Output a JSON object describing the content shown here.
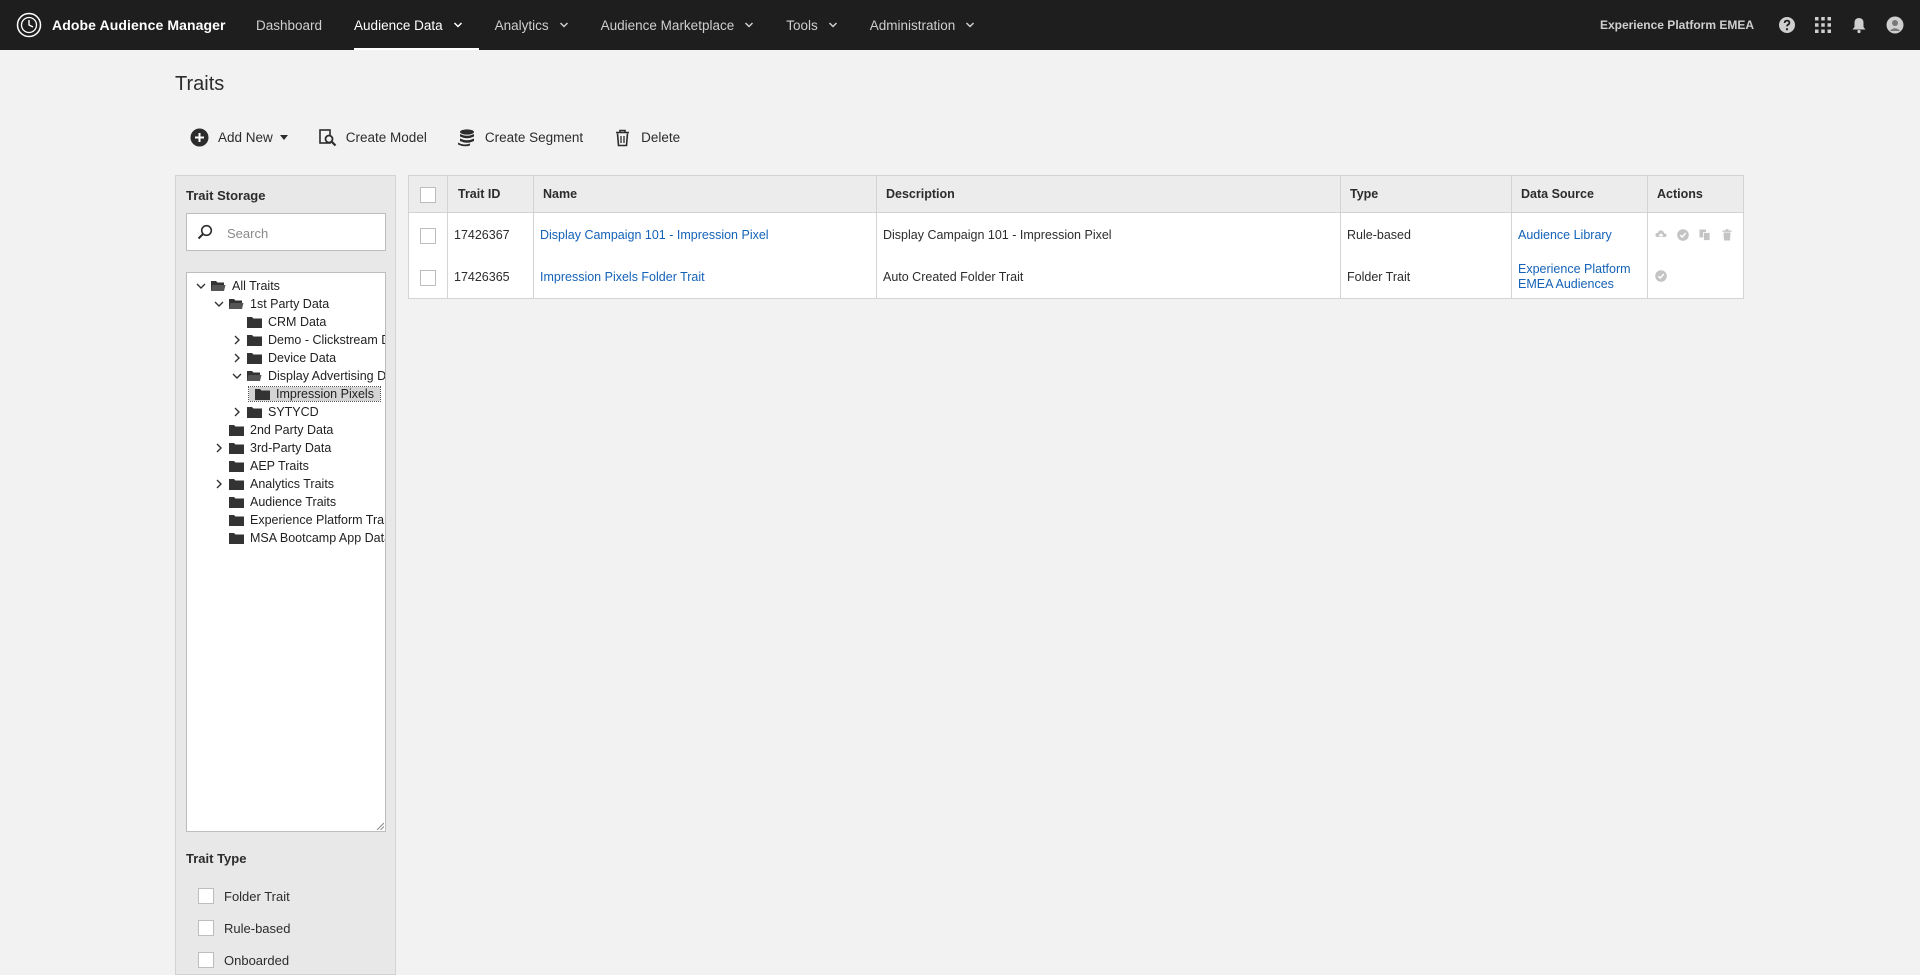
{
  "app": {
    "name": "Adobe Audience Manager"
  },
  "nav": {
    "items": [
      {
        "label": "Dashboard",
        "active": false,
        "dropdown": false
      },
      {
        "label": "Audience Data",
        "active": true,
        "dropdown": true
      },
      {
        "label": "Analytics",
        "active": false,
        "dropdown": true
      },
      {
        "label": "Audience Marketplace",
        "active": false,
        "dropdown": true
      },
      {
        "label": "Tools",
        "active": false,
        "dropdown": true
      },
      {
        "label": "Administration",
        "active": false,
        "dropdown": true
      }
    ],
    "org": "Experience Platform EMEA",
    "icons": [
      "help-icon",
      "apps-grid-icon",
      "bell-icon",
      "avatar-icon"
    ]
  },
  "page": {
    "title": "Traits"
  },
  "toolbar": {
    "add_new": "Add New",
    "create_model": "Create Model",
    "create_segment": "Create Segment",
    "delete": "Delete"
  },
  "trait_storage": {
    "heading": "Trait Storage",
    "search_placeholder": "Search",
    "tree": [
      {
        "label": "All Traits",
        "level": 0,
        "state": "expanded"
      },
      {
        "label": "1st Party Data",
        "level": 1,
        "state": "expanded"
      },
      {
        "label": "CRM Data",
        "level": 2,
        "state": "leaf"
      },
      {
        "label": "Demo - Clickstream Data",
        "level": 2,
        "state": "collapsed"
      },
      {
        "label": "Device Data",
        "level": 2,
        "state": "collapsed"
      },
      {
        "label": "Display Advertising Data",
        "level": 2,
        "state": "expanded"
      },
      {
        "label": "Impression Pixels",
        "level": 3,
        "state": "leaf",
        "selected": true
      },
      {
        "label": "SYTYCD",
        "level": 2,
        "state": "collapsed"
      },
      {
        "label": "2nd Party Data",
        "level": 1,
        "state": "leaf"
      },
      {
        "label": "3rd-Party Data",
        "level": 1,
        "state": "collapsed"
      },
      {
        "label": "AEP Traits",
        "level": 1,
        "state": "leaf"
      },
      {
        "label": "Analytics Traits",
        "level": 1,
        "state": "collapsed"
      },
      {
        "label": "Audience Traits",
        "level": 1,
        "state": "leaf"
      },
      {
        "label": "Experience Platform Traits",
        "level": 1,
        "state": "leaf"
      },
      {
        "label": "MSA Bootcamp App Data",
        "level": 1,
        "state": "leaf"
      }
    ]
  },
  "trait_type": {
    "heading": "Trait Type",
    "options": [
      "Folder Trait",
      "Rule-based",
      "Onboarded"
    ]
  },
  "table": {
    "columns": [
      "Trait ID",
      "Name",
      "Description",
      "Type",
      "Data Source",
      "Actions"
    ],
    "rows": [
      {
        "trait_id": "17426367",
        "name": "Display Campaign 101 - Impression Pixel",
        "description": "Display Campaign 101 - Impression Pixel",
        "type": "Rule-based",
        "data_source": [
          "Audience Library"
        ],
        "actions": [
          "upload-icon",
          "check-circle-icon",
          "copy-icon",
          "trash-icon"
        ]
      },
      {
        "trait_id": "17426365",
        "name": "Impression Pixels Folder Trait",
        "description": "Auto Created Folder Trait",
        "type": "Folder Trait",
        "data_source": [
          "Experience Platform",
          "EMEA Audiences"
        ],
        "actions": [
          "check-circle-icon"
        ]
      }
    ]
  },
  "colors": {
    "topbar": "#1e1e1e",
    "link": "#1462b8",
    "background": "#f2f2f2"
  }
}
